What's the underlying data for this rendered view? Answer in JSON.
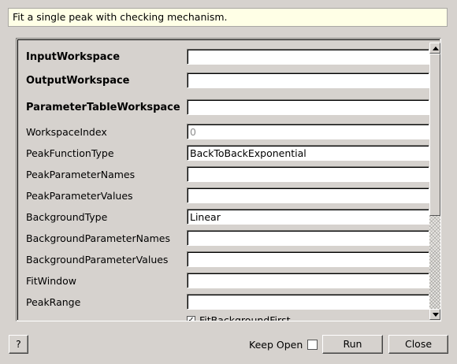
{
  "description": "Fit a single peak with checking mechanism.",
  "properties": [
    {
      "label": "InputWorkspace",
      "value": "",
      "bold": true
    },
    {
      "label": "OutputWorkspace",
      "value": "",
      "bold": true
    },
    {
      "label": "ParameterTableWorkspace",
      "value": "",
      "bold": true
    },
    {
      "label": "WorkspaceIndex",
      "value": "0",
      "bold": false,
      "disabled": true
    },
    {
      "label": "PeakFunctionType",
      "value": "BackToBackExponential",
      "bold": false
    },
    {
      "label": "PeakParameterNames",
      "value": "",
      "bold": false
    },
    {
      "label": "PeakParameterValues",
      "value": "",
      "bold": false
    },
    {
      "label": "BackgroundType",
      "value": "Linear",
      "bold": false
    },
    {
      "label": "BackgroundParameterNames",
      "value": "",
      "bold": false
    },
    {
      "label": "BackgroundParameterValues",
      "value": "",
      "bold": false
    },
    {
      "label": "FitWindow",
      "value": "",
      "bold": false
    },
    {
      "label": "PeakRange",
      "value": "",
      "bold": false
    }
  ],
  "fit_background_first": {
    "label": "FitBackgroundFirst",
    "checked": true
  },
  "footer": {
    "help_label": "?",
    "keep_open_label": "Keep Open",
    "keep_open_checked": false,
    "run_label": "Run",
    "close_label": "Close"
  }
}
